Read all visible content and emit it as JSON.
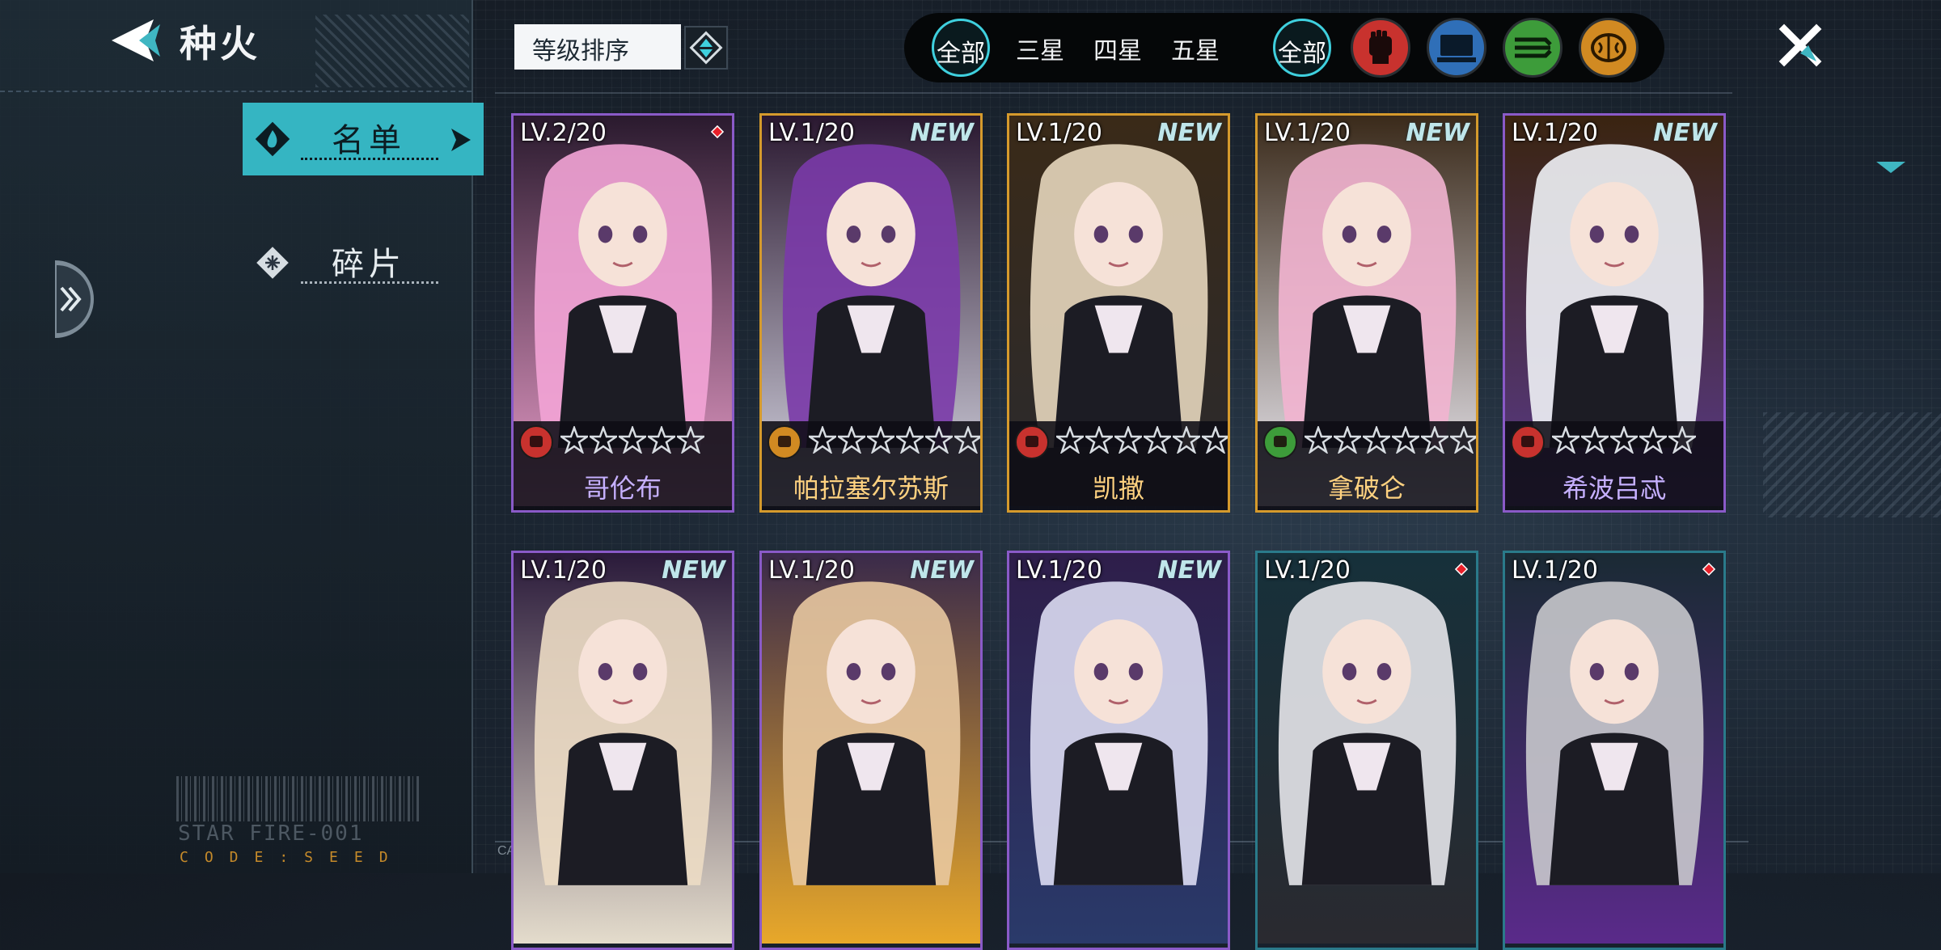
{
  "header": {
    "title": "种火"
  },
  "nav": [
    {
      "label": "名单",
      "active": true
    },
    {
      "label": "碎片",
      "active": false
    }
  ],
  "footer": {
    "barcode_text": "STAR FIRE-001",
    "code_text": "CODE:SEED",
    "small_mark": "CASSHERN LIST"
  },
  "sort": {
    "label": "等级排序"
  },
  "filters": {
    "star_all": "全部",
    "stars": [
      "三星",
      "四星",
      "五星"
    ],
    "type_all": "全部",
    "types": [
      {
        "icon": "fist-icon",
        "color": "#c8322e"
      },
      {
        "icon": "computer-icon",
        "color": "#2f6fb8"
      },
      {
        "icon": "speed-icon",
        "color": "#3d9c3a"
      },
      {
        "icon": "brain-icon",
        "color": "#d18a22"
      }
    ]
  },
  "cards": [
    {
      "level": "LV.2/20",
      "badge": "",
      "diamond": true,
      "type": "fist-icon",
      "stars": 5,
      "name": "哥伦布",
      "name_color": "#c6b0ff",
      "frame": "#8a5ac8",
      "bg1": "#2a1a2e",
      "bg2": "#e89cc8",
      "hair": "#f3a4d6"
    },
    {
      "level": "LV.1/20",
      "badge": "NEW",
      "diamond": false,
      "type": "brain-icon",
      "stars": 6,
      "name": "帕拉塞尔苏斯",
      "name_color": "#ffd280",
      "frame": "#d59a2c",
      "bg1": "#2a1830",
      "bg2": "#d8d8e4",
      "hair": "#7a3aa8"
    },
    {
      "level": "LV.1/20",
      "badge": "NEW",
      "diamond": false,
      "type": "fist-icon",
      "stars": 6,
      "name": "凯撒",
      "name_color": "#ffd280",
      "frame": "#d59a2c",
      "bg1": "#3a2a18",
      "bg2": "#2a2a2e",
      "hair": "#e6d6bc"
    },
    {
      "level": "LV.1/20",
      "badge": "NEW",
      "diamond": false,
      "type": "speed-icon",
      "stars": 6,
      "name": "拿破仑",
      "name_color": "#ffd280",
      "frame": "#d59a2c",
      "bg1": "#3a2a1a",
      "bg2": "#f0eef6",
      "hair": "#f2b4d0"
    },
    {
      "level": "LV.1/20",
      "badge": "NEW",
      "diamond": false,
      "type": "fist-icon",
      "stars": 5,
      "name": "希波吕忒",
      "name_color": "#c6b0ff",
      "frame": "#8a5ac8",
      "bg1": "#3a2410",
      "bg2": "#5a3a8a",
      "hair": "#f0f2f6"
    },
    {
      "level": "LV.1/20",
      "badge": "NEW",
      "diamond": false,
      "type": "",
      "stars": 0,
      "name": "",
      "name_color": "#c6b0ff",
      "frame": "#8a5ac8",
      "bg1": "#2a1a3a",
      "bg2": "#e4dccc",
      "hair": "#ecdcc4"
    },
    {
      "level": "LV.1/20",
      "badge": "NEW",
      "diamond": false,
      "type": "",
      "stars": 0,
      "name": "",
      "name_color": "#c6b0ff",
      "frame": "#8a5ac8",
      "bg1": "#3a2a4a",
      "bg2": "#e8a82a",
      "hair": "#e8c8a0"
    },
    {
      "level": "LV.1/20",
      "badge": "NEW",
      "diamond": false,
      "type": "",
      "stars": 0,
      "name": "",
      "name_color": "#c6b0ff",
      "frame": "#8a5ac8",
      "bg1": "#2e1e4a",
      "bg2": "#2a3a6a",
      "hair": "#dcdcf2"
    },
    {
      "level": "LV.1/20",
      "badge": "",
      "diamond": true,
      "type": "",
      "stars": 0,
      "name": "",
      "name_color": "#9fdce6",
      "frame": "#2a7a8a",
      "bg1": "#16303a",
      "bg2": "#2a2a30",
      "hair": "#e6e6ea"
    },
    {
      "level": "LV.1/20",
      "badge": "",
      "diamond": true,
      "type": "",
      "stars": 0,
      "name": "",
      "name_color": "#9fdce6",
      "frame": "#2a7a8a",
      "bg1": "#1a2a34",
      "bg2": "#5a2a8a",
      "hair": "#c8c8cc"
    }
  ]
}
